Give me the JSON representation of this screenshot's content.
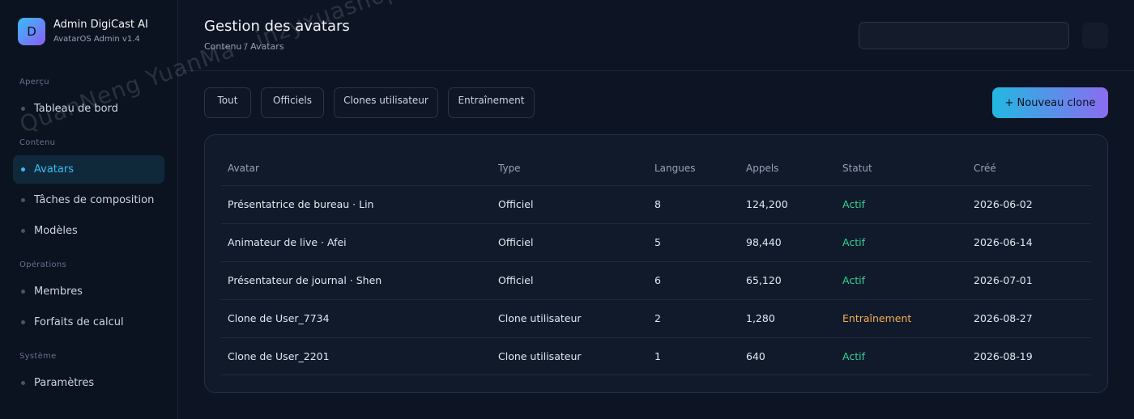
{
  "brand": {
    "logo_letter": "D",
    "name": "Admin DigiCast AI",
    "subtitle": "AvatarOS Admin v1.4"
  },
  "sidebar": {
    "sections": [
      {
        "title": "Aperçu",
        "items": [
          {
            "label": "Tableau de bord",
            "active": false
          }
        ]
      },
      {
        "title": "Contenu",
        "items": [
          {
            "label": "Avatars",
            "active": true
          },
          {
            "label": "Tâches de composition",
            "active": false
          },
          {
            "label": "Modèles",
            "active": false
          }
        ]
      },
      {
        "title": "Opérations",
        "items": [
          {
            "label": "Membres",
            "active": false
          },
          {
            "label": "Forfaits de calcul",
            "active": false
          }
        ]
      },
      {
        "title": "Système",
        "items": [
          {
            "label": "Paramètres",
            "active": false
          }
        ]
      }
    ]
  },
  "header": {
    "title": "Gestion des avatars",
    "breadcrumb": "Contenu / Avatars",
    "search": {
      "value": "",
      "placeholder": ""
    }
  },
  "filters": [
    "Tout",
    "Officiels",
    "Clones utilisateur",
    "Entraînement"
  ],
  "new_button_label": "+ Nouveau clone",
  "table": {
    "columns": [
      "Avatar",
      "Type",
      "Langues",
      "Appels",
      "Statut",
      "Créé"
    ],
    "rows": [
      [
        "Présentatrice de bureau · Lin",
        "Officiel",
        "8",
        "124,200",
        "Actif",
        "2026-06-02"
      ],
      [
        "Animateur de live · Afei",
        "Officiel",
        "5",
        "98,440",
        "Actif",
        "2026-06-14"
      ],
      [
        "Présentateur de journal · Shen",
        "Officiel",
        "6",
        "65,120",
        "Actif",
        "2026-07-01"
      ],
      [
        "Clone de User_7734",
        "Clone utilisateur",
        "2",
        "1,280",
        "Entraînement",
        "2026-08-27"
      ],
      [
        "Clone de User_2201",
        "Clone utilisateur",
        "1",
        "640",
        "Actif",
        "2026-08-19"
      ]
    ]
  },
  "colors": {
    "accent": "#38bdf8",
    "status_active": "#34d399",
    "status_training": "#f6ad55",
    "background": "#0d1424"
  },
  "watermark": "QuanNeng YuanMa · inzyxuashop.com"
}
